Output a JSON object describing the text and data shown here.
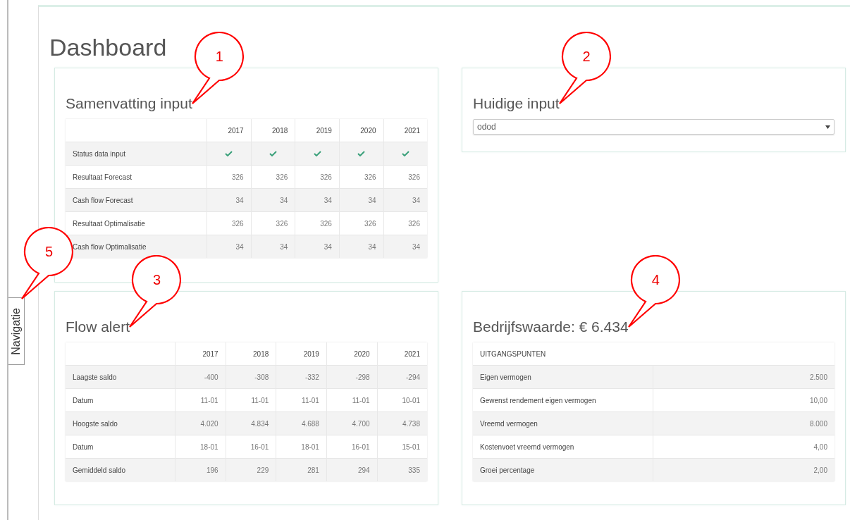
{
  "navigation": {
    "label": "Navigatie",
    "callout": "5"
  },
  "title": "Dashboard",
  "cards": [
    {
      "kind": "year-table",
      "title": "Samenvatting input",
      "callout": "1",
      "columns": [
        "2017",
        "2018",
        "2019",
        "2020",
        "2021"
      ],
      "rows": [
        {
          "label": "Status data input",
          "cells": [
            {
              "kind": "check",
              "checked": true
            },
            {
              "kind": "check",
              "checked": true
            },
            {
              "kind": "check",
              "checked": true
            },
            {
              "kind": "check",
              "checked": true
            },
            {
              "kind": "check",
              "checked": true
            }
          ]
        },
        {
          "label": "Resultaat Forecast",
          "cells": [
            {
              "kind": "text",
              "text": "326"
            },
            {
              "kind": "text",
              "text": "326"
            },
            {
              "kind": "text",
              "text": "326"
            },
            {
              "kind": "text",
              "text": "326"
            },
            {
              "kind": "text",
              "text": "326"
            }
          ]
        },
        {
          "label": "Cash flow Forecast",
          "cells": [
            {
              "kind": "text",
              "text": "34"
            },
            {
              "kind": "text",
              "text": "34"
            },
            {
              "kind": "text",
              "text": "34"
            },
            {
              "kind": "text",
              "text": "34"
            },
            {
              "kind": "text",
              "text": "34"
            }
          ]
        },
        {
          "label": "Resultaat Optimalisatie",
          "cells": [
            {
              "kind": "text",
              "text": "326"
            },
            {
              "kind": "text",
              "text": "326"
            },
            {
              "kind": "text",
              "text": "326"
            },
            {
              "kind": "text",
              "text": "326"
            },
            {
              "kind": "text",
              "text": "326"
            }
          ]
        },
        {
          "label": "Cash flow Optimalisatie",
          "cells": [
            {
              "kind": "text",
              "text": "34"
            },
            {
              "kind": "text",
              "text": "34"
            },
            {
              "kind": "text",
              "text": "34"
            },
            {
              "kind": "text",
              "text": "34"
            },
            {
              "kind": "text",
              "text": "34"
            }
          ]
        }
      ]
    },
    {
      "kind": "select",
      "title": "Huidige input",
      "callout": "2",
      "select": {
        "value": "odod"
      }
    },
    {
      "kind": "year-table",
      "title": "Flow alert",
      "callout": "3",
      "columns": [
        "2017",
        "2018",
        "2019",
        "2020",
        "2021"
      ],
      "rows": [
        {
          "label": "Laagste saldo",
          "cells": [
            {
              "kind": "text",
              "text": "-400"
            },
            {
              "kind": "text",
              "text": "-308"
            },
            {
              "kind": "text",
              "text": "-332"
            },
            {
              "kind": "text",
              "text": "-298"
            },
            {
              "kind": "text",
              "text": "-294"
            }
          ]
        },
        {
          "label": "Datum",
          "cells": [
            {
              "kind": "text",
              "text": "11-01"
            },
            {
              "kind": "text",
              "text": "11-01"
            },
            {
              "kind": "text",
              "text": "11-01"
            },
            {
              "kind": "text",
              "text": "11-01"
            },
            {
              "kind": "text",
              "text": "10-01"
            }
          ]
        },
        {
          "label": "Hoogste saldo",
          "cells": [
            {
              "kind": "text",
              "text": "4.020"
            },
            {
              "kind": "text",
              "text": "4.834"
            },
            {
              "kind": "text",
              "text": "4.688"
            },
            {
              "kind": "text",
              "text": "4.700"
            },
            {
              "kind": "text",
              "text": "4.738"
            }
          ]
        },
        {
          "label": "Datum",
          "cells": [
            {
              "kind": "text",
              "text": "18-01"
            },
            {
              "kind": "text",
              "text": "16-01"
            },
            {
              "kind": "text",
              "text": "18-01"
            },
            {
              "kind": "text",
              "text": "16-01"
            },
            {
              "kind": "text",
              "text": "15-01"
            }
          ]
        },
        {
          "label": "Gemiddeld saldo",
          "cells": [
            {
              "kind": "text",
              "text": "196"
            },
            {
              "kind": "text",
              "text": "229"
            },
            {
              "kind": "text",
              "text": "281"
            },
            {
              "kind": "text",
              "text": "294"
            },
            {
              "kind": "text",
              "text": "335"
            }
          ]
        }
      ]
    },
    {
      "kind": "value-table",
      "title": "Bedrijfswaarde: € 6.434",
      "callout": "4",
      "heading": "UITGANGSPUNTEN",
      "rows": [
        {
          "label": "Eigen vermogen",
          "value": "2.500"
        },
        {
          "label": "Gewenst rendement eigen vermogen",
          "value": "10,00"
        },
        {
          "label": "Vreemd vermogen",
          "value": "8.000"
        },
        {
          "label": "Kostenvoet vreemd vermogen",
          "value": "4,00"
        },
        {
          "label": "Groei percentage",
          "value": "2,00"
        }
      ]
    }
  ]
}
